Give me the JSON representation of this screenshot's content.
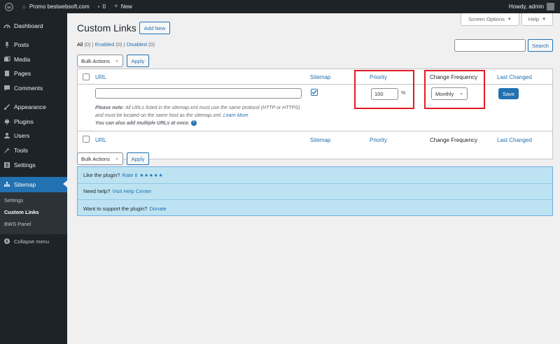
{
  "adminbar": {
    "site_name": "Promo bestwebsoft.com",
    "comments_count": "0",
    "new_label": "New",
    "howdy": "Howdy, admin"
  },
  "sidebar": {
    "items": [
      {
        "label": "Dashboard",
        "icon": "dashboard-icon"
      },
      {
        "label": "Posts",
        "icon": "pin-icon"
      },
      {
        "label": "Media",
        "icon": "media-icon"
      },
      {
        "label": "Pages",
        "icon": "page-icon"
      },
      {
        "label": "Comments",
        "icon": "comment-icon"
      },
      {
        "label": "Appearance",
        "icon": "brush-icon"
      },
      {
        "label": "Plugins",
        "icon": "plug-icon"
      },
      {
        "label": "Users",
        "icon": "user-icon"
      },
      {
        "label": "Tools",
        "icon": "wrench-icon"
      },
      {
        "label": "Settings",
        "icon": "settings-icon"
      },
      {
        "label": "Sitemap",
        "icon": "sitemap-icon"
      }
    ],
    "submenu": [
      "Settings",
      "Custom Links",
      "BWS Panel"
    ],
    "collapse": "Collapse menu"
  },
  "header": {
    "title": "Custom Links",
    "add_new": "Add New",
    "screen_options": "Screen Options",
    "help": "Help"
  },
  "filters": {
    "all": "All",
    "all_count": "(0)",
    "enabled": "Enabled",
    "enabled_count": "(0)",
    "disabled": "Disabled",
    "disabled_count": "(0)",
    "sep": "|"
  },
  "search": {
    "button": "Search",
    "value": ""
  },
  "bulk": {
    "label": "Bulk Actions",
    "apply": "Apply"
  },
  "table": {
    "columns": {
      "url": "URL",
      "sitemap": "Sitemap",
      "priority": "Priority",
      "change_frequency": "Change Frequency",
      "last_changed": "Last Changed"
    },
    "row": {
      "url_value": "",
      "priority_value": "100",
      "percent": "%",
      "frequency": "Monthly",
      "save": "Save",
      "note_bold": "Please note:",
      "note_text_1": "All URLs listed in the sitemap.xml must use the same protocol (HTTP or HTTPS) and must be located on the same host as the sitemap.xml.",
      "learn_more": "Learn More",
      "note_bold_2": "You can also add multiple URLs at once.",
      "help_glyph": "?"
    }
  },
  "notices": {
    "like_text": "Like the plugin?",
    "rate_it": "Rate it",
    "stars": "★★★★★",
    "help_text": "Need help?",
    "help_center": "Visit Help Center",
    "support_text": "Want to support the plugin?",
    "donate": "Donate"
  },
  "colors": {
    "accent": "#2271b1",
    "sidebar_bg": "#1d2327",
    "highlight_box": "#e31b23",
    "notice_bg": "#bde3f2"
  }
}
